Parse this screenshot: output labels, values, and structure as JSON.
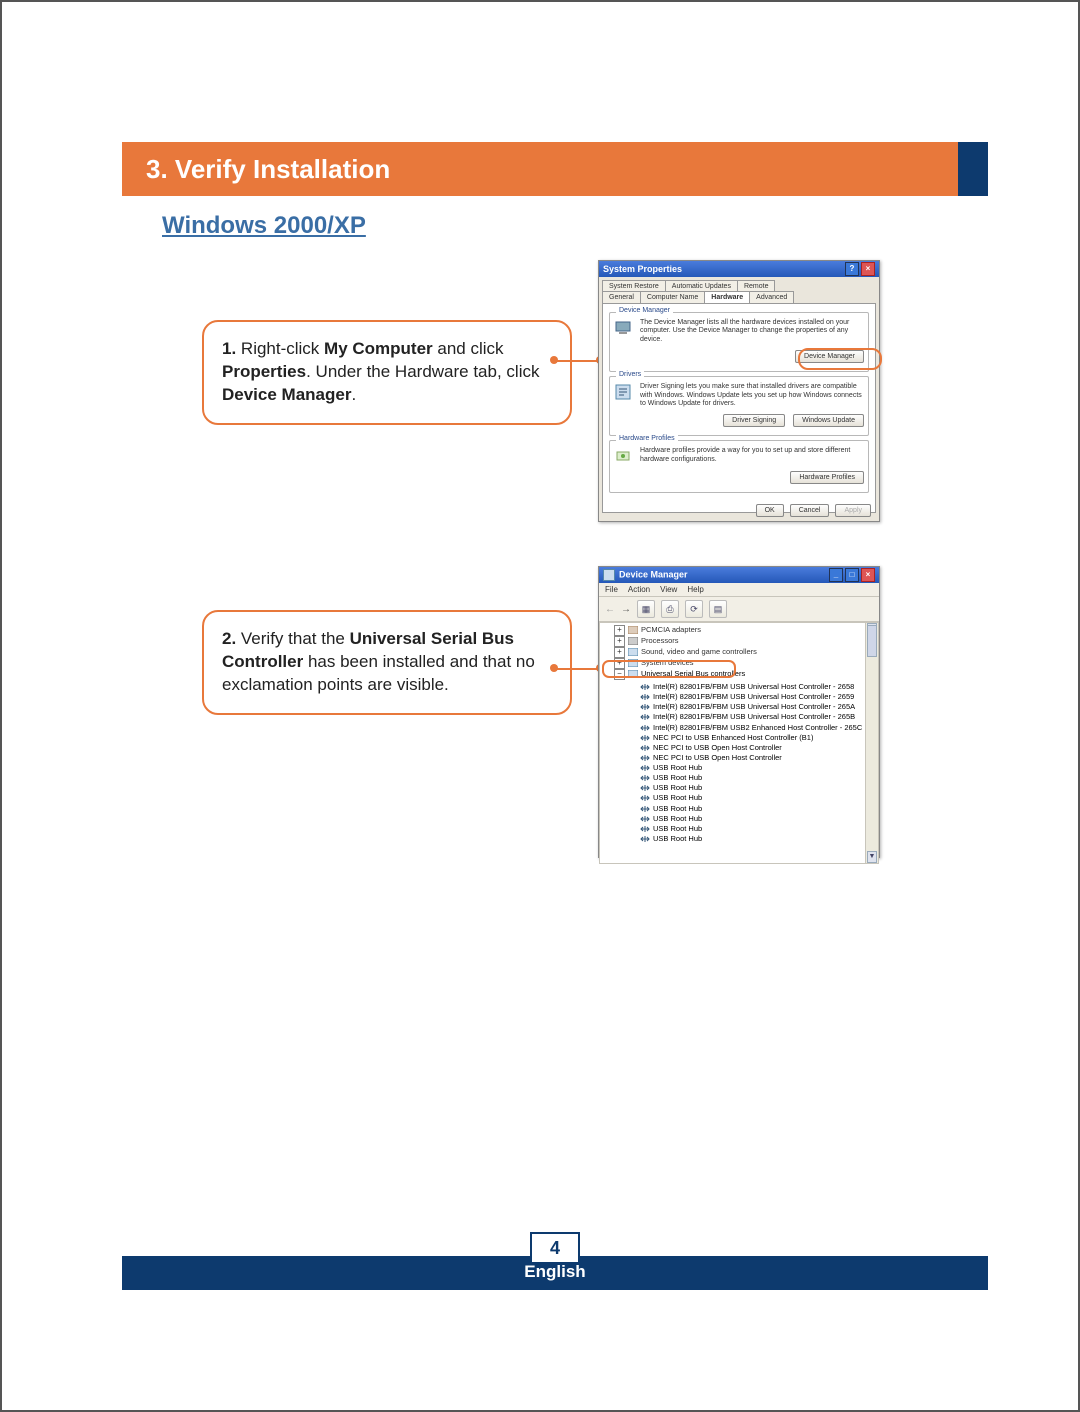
{
  "header": {
    "section_number": "3.",
    "section_title": "Verify Installation"
  },
  "subheading": "Windows 2000/XP",
  "callouts": {
    "step1": {
      "num": "1.",
      "pre": " Right-click ",
      "b1": "My Computer",
      "mid1": " and click ",
      "b2": "Properties",
      "mid2": ". Under the Hardware tab, click ",
      "b3": "Device Manager",
      "post": "."
    },
    "step2": {
      "num": "2.",
      "pre": " Verify that the ",
      "b1": "Universal Serial Bus Controller",
      "post": " has been installed and that no exclamation points are visible."
    }
  },
  "sysprop": {
    "title": "System Properties",
    "tabs_row1": [
      "System Restore",
      "Automatic Updates",
      "Remote"
    ],
    "tabs_row2": [
      "General",
      "Computer Name",
      "Hardware",
      "Advanced"
    ],
    "active_tab": "Hardware",
    "grp_devman": {
      "title": "Device Manager",
      "text": "The Device Manager lists all the hardware devices installed on your computer. Use the Device Manager to change the properties of any device.",
      "btn": "Device Manager"
    },
    "grp_drivers": {
      "title": "Drivers",
      "text": "Driver Signing lets you make sure that installed drivers are compatible with Windows. Windows Update lets you set up how Windows connects to Windows Update for drivers.",
      "btn1": "Driver Signing",
      "btn2": "Windows Update"
    },
    "grp_hw": {
      "title": "Hardware Profiles",
      "text": "Hardware profiles provide a way for you to set up and store different hardware configurations.",
      "btn": "Hardware Profiles"
    },
    "buttons": {
      "ok": "OK",
      "cancel": "Cancel",
      "apply": "Apply"
    }
  },
  "devmgr": {
    "title": "Device Manager",
    "menu": [
      "File",
      "Action",
      "View",
      "Help"
    ],
    "tree_top": [
      "PCMCIA adapters",
      "Processors",
      "Sound, video and game controllers",
      "System devices"
    ],
    "usb_label": "Universal Serial Bus controllers",
    "usb_children": [
      "Intel(R) 82801FB/FBM USB Universal Host Controller - 2658",
      "Intel(R) 82801FB/FBM USB Universal Host Controller - 2659",
      "Intel(R) 82801FB/FBM USB Universal Host Controller - 265A",
      "Intel(R) 82801FB/FBM USB Universal Host Controller - 265B",
      "Intel(R) 82801FB/FBM USB2 Enhanced Host Controller - 265C",
      "NEC PCI to USB Enhanced Host Controller (B1)",
      "NEC PCI to USB Open Host Controller",
      "NEC PCI to USB Open Host Controller",
      "USB Root Hub",
      "USB Root Hub",
      "USB Root Hub",
      "USB Root Hub",
      "USB Root Hub",
      "USB Root Hub",
      "USB Root Hub",
      "USB Root Hub"
    ]
  },
  "footer": {
    "page": "4",
    "language": "English"
  }
}
